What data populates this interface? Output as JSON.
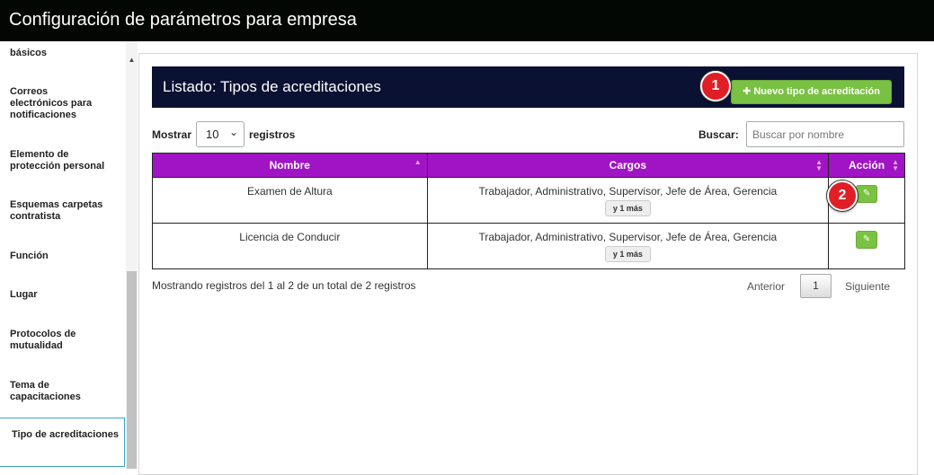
{
  "window": {
    "title": "Configuración de parámetros para empresa"
  },
  "sidebar": {
    "items": [
      {
        "label": "básicos"
      },
      {
        "label": "Correos electrónicos para notificaciones"
      },
      {
        "label": "Elemento de protección personal"
      },
      {
        "label": "Esquemas carpetas contratista"
      },
      {
        "label": "Función"
      },
      {
        "label": "Lugar"
      },
      {
        "label": "Protocolos de mutualidad"
      },
      {
        "label": "Tema de capacitaciones"
      },
      {
        "label": "Tipo de acreditaciones"
      }
    ],
    "active": "Tipo de acreditaciones"
  },
  "panel": {
    "title": "Listado: Tipos de acreditaciones",
    "new_button": "✚ Nuevo tipo de acreditación"
  },
  "controls": {
    "show_label": "Mostrar",
    "show_value": "10",
    "records_label": "registros",
    "search_label": "Buscar:",
    "search_placeholder": "Buscar por nombre"
  },
  "table": {
    "headers": [
      "Nombre",
      "Cargos",
      "Acción"
    ],
    "rows": [
      {
        "nombre": "Examen de Altura",
        "cargos": "Trabajador, Administrativo, Supervisor, Jefe de Área, Gerencia",
        "more": "y 1 más"
      },
      {
        "nombre": "Licencia de Conducir",
        "cargos": "Trabajador, Administrativo, Supervisor, Jefe de Área, Gerencia",
        "more": "y 1 más"
      }
    ]
  },
  "footer": {
    "info": "Mostrando registros del 1 al 2 de un total de 2 registros",
    "prev": "Anterior",
    "page": "1",
    "next": "Siguiente"
  },
  "markers": [
    "1",
    "2"
  ],
  "colors": {
    "topbar": "#030703",
    "panel_header": "#0a1132",
    "table_header": "#a114c5",
    "button_green": "#79c143",
    "marker_red": "#e01e26",
    "active_border": "#3aa3c9"
  },
  "icons": {
    "edit": "pencil-icon",
    "new": "plus-icon",
    "scroll": "scroll-up-arrow-icon"
  }
}
